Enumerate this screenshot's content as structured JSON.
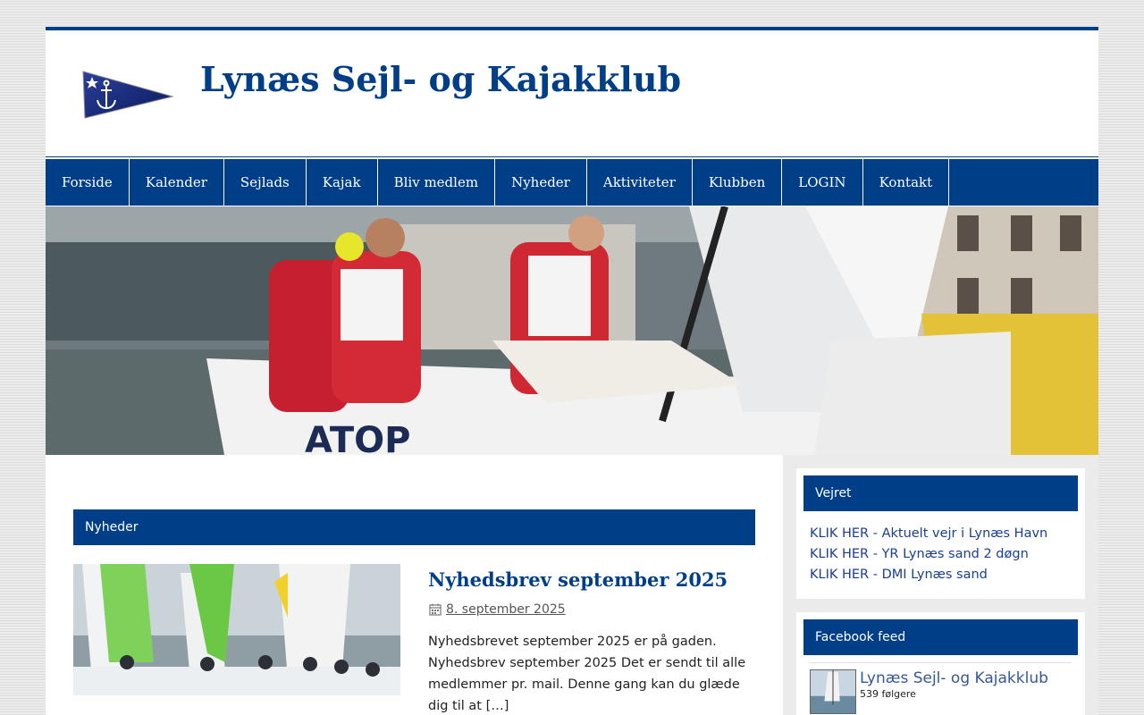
{
  "site": {
    "title": "Lynæs Sejl- og Kajakklub"
  },
  "nav": {
    "items": [
      "Forside",
      "Kalender",
      "Sejlads",
      "Kajak",
      "Bliv medlem",
      "Nyheder",
      "Aktiviteter",
      "Klubben",
      "LOGIN",
      "Kontakt"
    ]
  },
  "main": {
    "section_title": "Nyheder",
    "post": {
      "title": "Nyhedsbrev september 2025",
      "date": "8. september 2025",
      "excerpt": "Nyhedsbrevet september 2025 er på gaden. Nyhedsbrev september 2025 Det er sendt til alle medlemmer pr. mail. Denne gang kan du glæde dig til at […]"
    }
  },
  "sidebar": {
    "weather": {
      "title": "Vejret",
      "links": [
        "KLIK HER - Aktuelt vejr i Lynæs Havn",
        "KLIK HER - YR Lynæs sand 2 døgn",
        "KLIK HER - DMI Lynæs sand"
      ]
    },
    "facebook": {
      "title": "Facebook feed",
      "page_name": "Lynæs Sejl- og Kajakklub",
      "followers": "539 følgere"
    }
  },
  "colors": {
    "brand": "#003f87",
    "link": "#1a3f8f",
    "facebook_link": "#365899"
  },
  "icons": {
    "logo": "burgee-flag-anchor",
    "date": "calendar-icon"
  }
}
